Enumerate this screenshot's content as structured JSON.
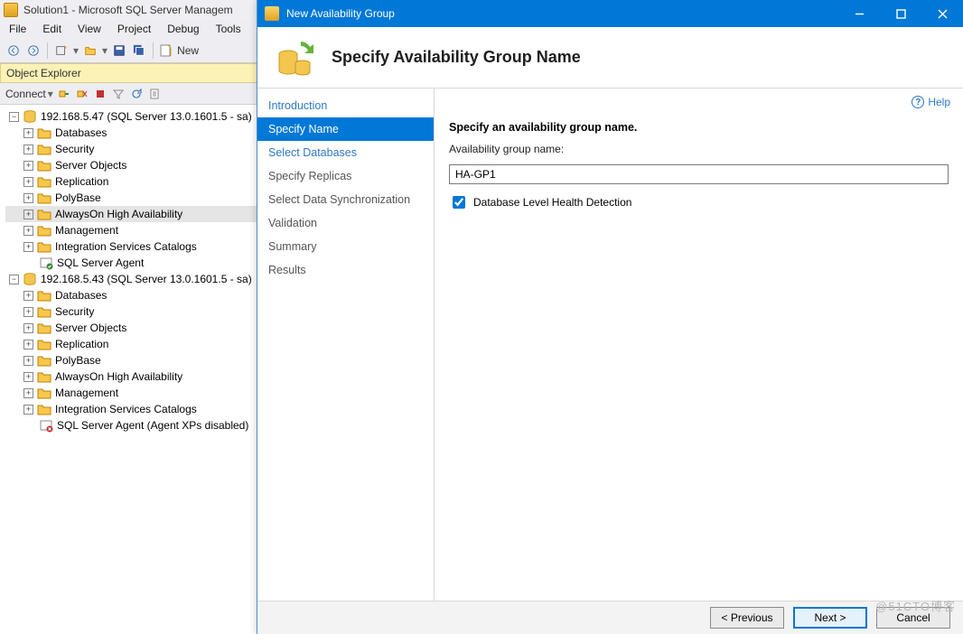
{
  "ssms": {
    "title": "Solution1 - Microsoft SQL Server Managem",
    "menus": [
      "File",
      "Edit",
      "View",
      "Project",
      "Debug",
      "Tools"
    ],
    "toolbar_new": "New",
    "explorer_title": "Object Explorer",
    "connect_label": "Connect",
    "servers": [
      {
        "label": "192.168.5.47 (SQL Server 13.0.1601.5 - sa)",
        "nodes": [
          "Databases",
          "Security",
          "Server Objects",
          "Replication",
          "PolyBase",
          "AlwaysOn High Availability",
          "Management",
          "Integration Services Catalogs",
          "SQL Server Agent"
        ],
        "selected": "AlwaysOn High Availability"
      },
      {
        "label": "192.168.5.43 (SQL Server 13.0.1601.5 - sa)",
        "nodes": [
          "Databases",
          "Security",
          "Server Objects",
          "Replication",
          "PolyBase",
          "AlwaysOn High Availability",
          "Management",
          "Integration Services Catalogs",
          "SQL Server Agent (Agent XPs disabled)"
        ]
      }
    ]
  },
  "wizard": {
    "window_title": "New Availability Group",
    "header_title": "Specify Availability Group Name",
    "nav": [
      {
        "label": "Introduction",
        "link": true
      },
      {
        "label": "Specify Name",
        "active": true
      },
      {
        "label": "Select Databases",
        "link": true
      },
      {
        "label": "Specify Replicas"
      },
      {
        "label": "Select Data Synchronization"
      },
      {
        "label": "Validation"
      },
      {
        "label": "Summary"
      },
      {
        "label": "Results"
      }
    ],
    "help_label": "Help",
    "content_heading": "Specify an availability group name.",
    "field_label": "Availability group name:",
    "field_value": "HA-GP1",
    "checkbox_label": "Database Level Health Detection",
    "checkbox_checked": true,
    "buttons": {
      "previous": "< Previous",
      "next": "Next >",
      "cancel": "Cancel"
    }
  },
  "watermark": "@51CTO博客"
}
